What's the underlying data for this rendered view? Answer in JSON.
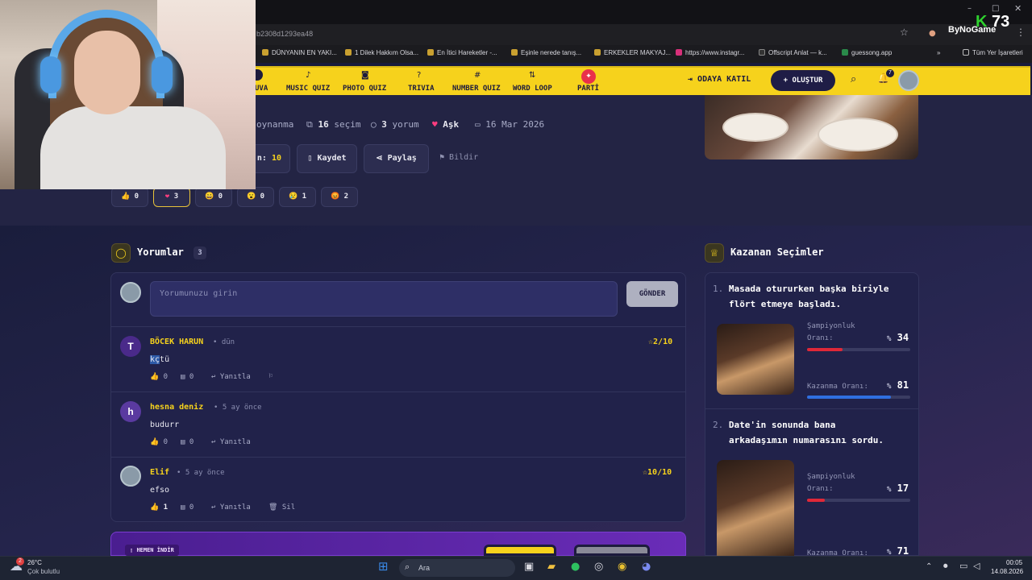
{
  "browser": {
    "url": "b2308d1293ea48",
    "bookmarks": [
      "DÜNYANIN EN YAKI...",
      "1 Dilek Hakkım Olsa...",
      "En İtici Hareketler -...",
      "Eşinle nerede tanış...",
      "ERKEKLER MAKYAJ...",
      "https://www.instagr...",
      "Offscript Anlat — k...",
      "guessong.app"
    ],
    "bookmarks_more": "»",
    "all_bookmarks": "Tüm Yer İşaretleri",
    "logo_text": "ByNoGame",
    "overlay_letter": "K",
    "overlay_number": "73"
  },
  "nav": {
    "items": [
      "UVA",
      "MUSIC QUIZ",
      "PHOTO QUIZ",
      "TRIVIA",
      "NUMBER QUIZ",
      "WORD LOOP",
      "PARTİ"
    ],
    "join": "ODAYA KATIL",
    "create": "+ OLUŞTUR",
    "notif_count": "7"
  },
  "hero": {
    "plays_label": "oynanma",
    "choices_num": "16",
    "choices_label": "seçim",
    "comments_num": "3",
    "comments_label": "yorum",
    "category": "Aşk",
    "date": "16 Mar 2026",
    "rating_partial": "n:",
    "rating_value": "10",
    "save": "Kaydet",
    "share": "Paylaş",
    "report": "Bildir"
  },
  "reactions": [
    {
      "emoji": "👍",
      "count": "0"
    },
    {
      "emoji": "❤",
      "count": "3"
    },
    {
      "emoji": "😄",
      "count": "0"
    },
    {
      "emoji": "😮",
      "count": "0"
    },
    {
      "emoji": "😢",
      "count": "1"
    },
    {
      "emoji": "😡",
      "count": "2"
    }
  ],
  "comments_section": {
    "title": "Yorumlar",
    "count": "3",
    "placeholder": "Yorumunuzu girin",
    "send": "GÖNDER",
    "items": [
      {
        "initial": "T",
        "name": "BÖCEK HARUN",
        "time": "• dün",
        "text_sel": "kç",
        "text_rest": "tü",
        "likes": "0",
        "replies": "0",
        "reply_label": "Yanıtla",
        "score": "2/10"
      },
      {
        "initial": "h",
        "name": "hesna deniz",
        "time": "• 5 ay önce",
        "text": "budurr",
        "likes": "0",
        "replies": "0",
        "reply_label": "Yanıtla"
      },
      {
        "name": "Elif",
        "time": "• 5 ay önce",
        "text": "efso",
        "likes": "1",
        "replies": "0",
        "reply_label": "Yanıtla",
        "delete_label": "Sil",
        "score": "10/10"
      }
    ]
  },
  "winners": {
    "title": "Kazanan Seçimler",
    "items": [
      {
        "num": "1.",
        "line1": "Masada otururken başka biriyle",
        "line2": "flört etmeye başladı.",
        "champ_label_1": "Şampiyonluk",
        "champ_label_2": "Oranı:",
        "champ_value": "34",
        "champ_fraction": 0.34,
        "win_label": "Kazanma Oranı:",
        "win_value": "81",
        "win_fraction": 0.81
      },
      {
        "num": "2.",
        "line1": "Date'in sonunda bana",
        "line2": "arkadaşımın numarasını sordu.",
        "champ_label_1": "Şampiyonluk",
        "champ_label_2": "Oranı:",
        "champ_value": "17",
        "champ_fraction": 0.17,
        "win_label": "Kazanma Oranı:",
        "win_value": "71",
        "win_fraction": 0.71
      }
    ],
    "percent_sign": "%"
  },
  "promo": {
    "label": "HEMEN İNDİR"
  },
  "taskbar": {
    "temp": "26°C",
    "weather": "Çok bulutlu",
    "weather_badge": "2",
    "search": "Ara",
    "time": "00:05",
    "date": "14.08.2026"
  },
  "colors": {
    "nav_yellow": "#f6d21c",
    "champ_bar": "#e02838",
    "win_bar": "#2f6fe0",
    "accent_yellow": "#f6d21c"
  }
}
